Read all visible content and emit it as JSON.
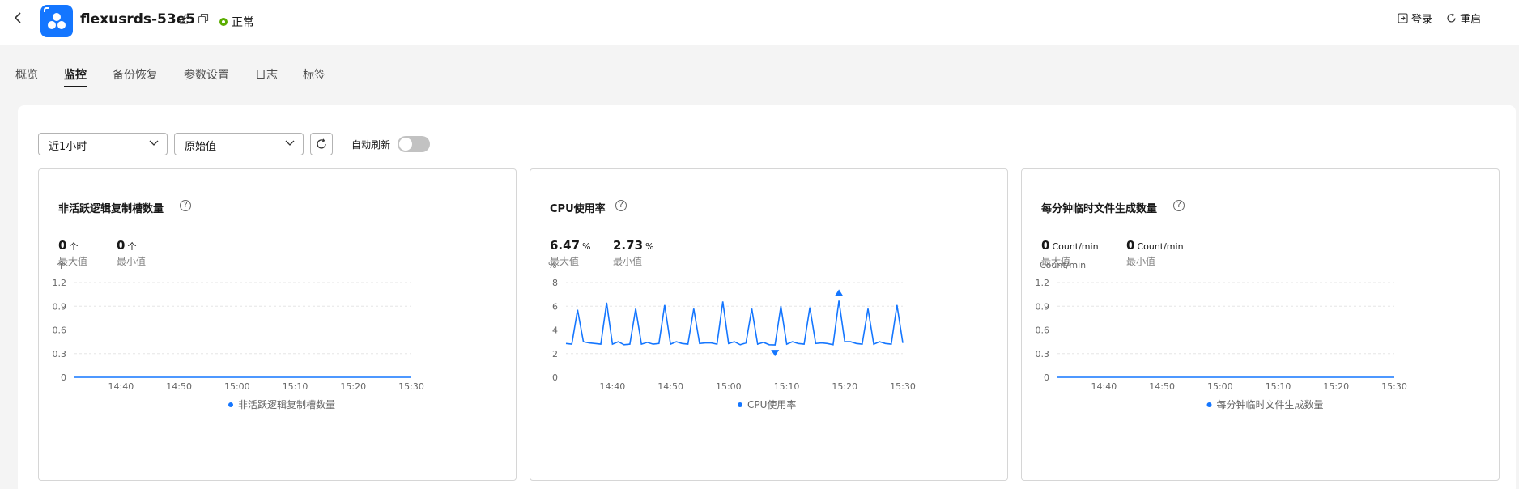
{
  "header": {
    "back_icon": "chevron-left-icon",
    "instance_name": "flexusrds-53e5",
    "status": "正常",
    "status_color": "#5aad00",
    "actions": [
      {
        "label": "登录",
        "icon": "login-icon"
      },
      {
        "label": "重启",
        "icon": "restart-icon"
      }
    ]
  },
  "tabs": [
    {
      "label": "概览",
      "active": false
    },
    {
      "label": "监控",
      "active": true
    },
    {
      "label": "备份恢复",
      "active": false
    },
    {
      "label": "参数设置",
      "active": false
    },
    {
      "label": "日志",
      "active": false
    },
    {
      "label": "标签",
      "active": false
    }
  ],
  "toolbar": {
    "time_range": "近1小时",
    "value_type": "原始值",
    "auto_refresh_label": "自动刷新",
    "auto_refresh_on": false
  },
  "colors": {
    "accent": "#1476ff",
    "series": "#1476ff"
  },
  "cards": [
    {
      "title": "非活跃逻辑复制槽数量",
      "max_value": "0",
      "max_unit": "个",
      "max_label": "最大值",
      "min_value": "0",
      "min_unit": "个",
      "min_label": "最小值"
    },
    {
      "title": "CPU使用率",
      "max_value": "6.47",
      "max_unit": "%",
      "max_label": "最大值",
      "min_value": "2.73",
      "min_unit": "%",
      "min_label": "最小值"
    },
    {
      "title": "每分钟临时文件生成数量",
      "max_value": "0",
      "max_unit": "Count/min",
      "max_label": "最大值",
      "min_value": "0",
      "min_unit": "Count/min",
      "min_label": "最小值"
    }
  ],
  "chart_data": [
    {
      "type": "line",
      "title": "非活跃逻辑复制槽数量",
      "ylabel": "个",
      "ylim": [
        0,
        1.2
      ],
      "y_ticks": [
        "0",
        "0.3",
        "0.6",
        "0.9",
        "1.2"
      ],
      "x_ticks": [
        "14:40",
        "14:50",
        "15:00",
        "15:10",
        "15:20",
        "15:30"
      ],
      "x_start": "14:32",
      "x_end": "15:30",
      "series": [
        {
          "name": "非活跃逻辑复制槽数量",
          "values": [
            0,
            0,
            0,
            0,
            0,
            0,
            0,
            0,
            0,
            0,
            0,
            0,
            0,
            0,
            0,
            0,
            0,
            0,
            0,
            0,
            0,
            0,
            0,
            0,
            0,
            0,
            0,
            0,
            0,
            0,
            0,
            0,
            0,
            0,
            0,
            0,
            0,
            0,
            0,
            0,
            0,
            0,
            0,
            0,
            0,
            0,
            0,
            0,
            0,
            0,
            0,
            0,
            0,
            0,
            0,
            0,
            0,
            0,
            0
          ]
        }
      ],
      "grid": true,
      "legend": "bottom"
    },
    {
      "type": "line",
      "title": "CPU使用率",
      "ylabel": "%",
      "ylim": [
        0,
        8
      ],
      "y_ticks": [
        "0",
        "2",
        "4",
        "6",
        "8"
      ],
      "x_ticks": [
        "14:40",
        "14:50",
        "15:00",
        "15:10",
        "15:20",
        "15:30"
      ],
      "x_start": "14:32",
      "x_end": "15:30",
      "series": [
        {
          "name": "CPU使用率",
          "values": [
            2.85,
            2.8,
            5.7,
            3.0,
            2.9,
            2.85,
            2.8,
            6.3,
            2.8,
            3.0,
            2.75,
            2.8,
            5.8,
            2.8,
            2.95,
            2.8,
            2.85,
            6.1,
            2.8,
            3.0,
            2.85,
            2.8,
            5.8,
            2.85,
            2.9,
            2.9,
            2.8,
            6.4,
            2.85,
            3.0,
            2.75,
            2.9,
            5.8,
            2.8,
            2.95,
            2.75,
            2.73,
            6.0,
            2.8,
            3.0,
            2.85,
            2.8,
            5.9,
            2.85,
            2.9,
            2.85,
            2.75,
            6.47,
            3.0,
            3.0,
            2.85,
            2.8,
            5.8,
            2.8,
            3.0,
            2.85,
            2.8,
            6.1,
            2.9
          ]
        }
      ],
      "max_marker": 6.47,
      "min_marker": 2.73,
      "grid": true,
      "legend": "bottom"
    },
    {
      "type": "line",
      "title": "每分钟临时文件生成数量",
      "ylabel": "Count/min",
      "ylim": [
        0,
        1.2
      ],
      "y_ticks": [
        "0",
        "0.3",
        "0.6",
        "0.9",
        "1.2"
      ],
      "x_ticks": [
        "14:40",
        "14:50",
        "15:00",
        "15:10",
        "15:20",
        "15:30"
      ],
      "x_start": "14:32",
      "x_end": "15:30",
      "series": [
        {
          "name": "每分钟临时文件生成数量",
          "values": [
            0,
            0,
            0,
            0,
            0,
            0,
            0,
            0,
            0,
            0,
            0,
            0,
            0,
            0,
            0,
            0,
            0,
            0,
            0,
            0,
            0,
            0,
            0,
            0,
            0,
            0,
            0,
            0,
            0,
            0,
            0,
            0,
            0,
            0,
            0,
            0,
            0,
            0,
            0,
            0,
            0,
            0,
            0,
            0,
            0,
            0,
            0,
            0,
            0,
            0,
            0,
            0,
            0,
            0,
            0,
            0,
            0,
            0,
            0
          ]
        }
      ],
      "grid": true,
      "legend": "bottom"
    }
  ]
}
